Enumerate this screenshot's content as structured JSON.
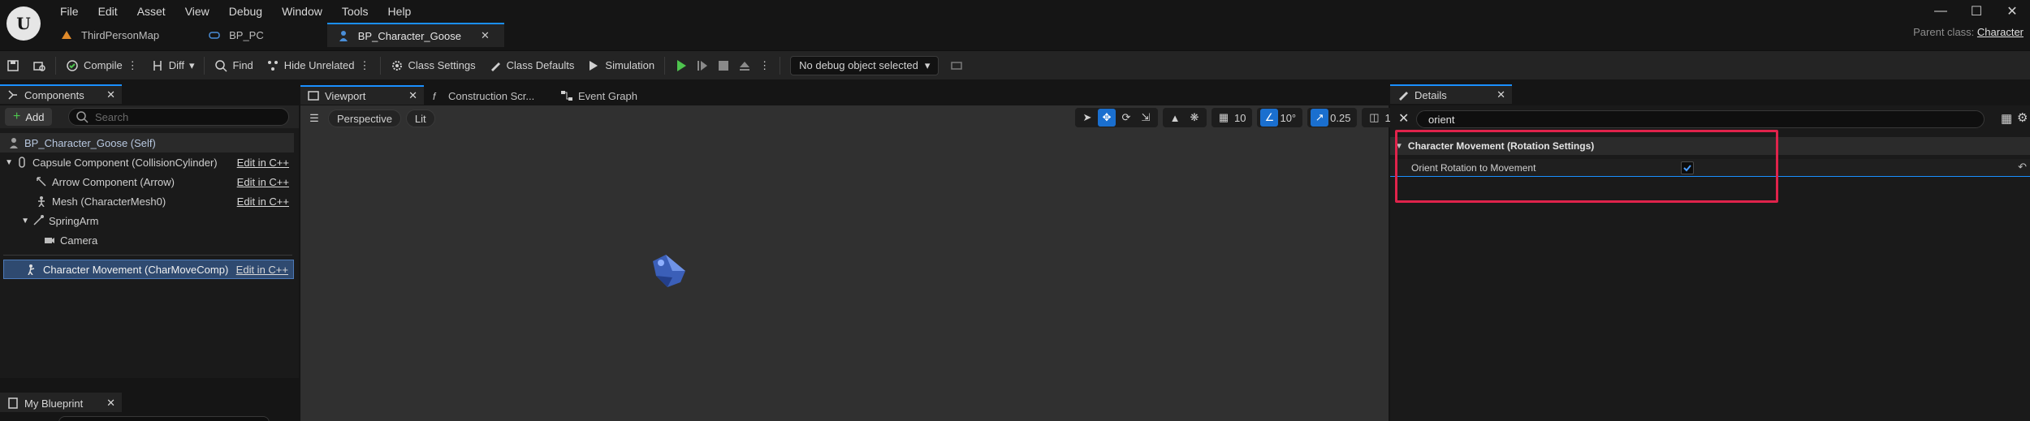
{
  "menu": [
    "File",
    "Edit",
    "Asset",
    "View",
    "Debug",
    "Window",
    "Tools",
    "Help"
  ],
  "doc_tabs": [
    {
      "label": "ThirdPersonMap",
      "active": false
    },
    {
      "label": "BP_PC",
      "active": false
    },
    {
      "label": "BP_Character_Goose",
      "active": true
    }
  ],
  "parent_class": {
    "label": "Parent class:",
    "value": "Character"
  },
  "toolbar": {
    "compile": "Compile",
    "diff": "Diff",
    "find": "Find",
    "hide_unrelated": "Hide Unrelated",
    "class_settings": "Class Settings",
    "class_defaults": "Class Defaults",
    "simulation": "Simulation",
    "debug_object": "No debug object selected"
  },
  "components": {
    "tab": "Components",
    "add": "Add",
    "search_placeholder": "Search",
    "edit_link": "Edit in C++",
    "items": [
      {
        "label": "BP_Character_Goose (Self)",
        "depth": 0
      },
      {
        "label": "Capsule Component (CollisionCylinder)",
        "depth": 1
      },
      {
        "label": "Arrow Component (Arrow)",
        "depth": 2
      },
      {
        "label": "Mesh (CharacterMesh0)",
        "depth": 2
      },
      {
        "label": "SpringArm",
        "depth": 2
      },
      {
        "label": "Camera",
        "depth": 3
      },
      {
        "label": "Character Movement (CharMoveComp)",
        "depth": 1
      }
    ]
  },
  "my_blueprint": {
    "tab": "My Blueprint"
  },
  "center_tabs": [
    "Viewport",
    "Construction Scr...",
    "Event Graph"
  ],
  "viewport": {
    "perspective": "Perspective",
    "lit": "Lit",
    "grid_snap": "10",
    "rotation_snap": "10°",
    "scale_snap": "0.25",
    "camera_speed": "1"
  },
  "details": {
    "tab": "Details",
    "search_value": "orient",
    "category": "Character Movement (Rotation Settings)",
    "property": "Orient Rotation to Movement",
    "checked": true
  },
  "colors": {
    "accent": "#1a8fff",
    "highlight": "#e0234b",
    "selection": "#2f4a70"
  }
}
